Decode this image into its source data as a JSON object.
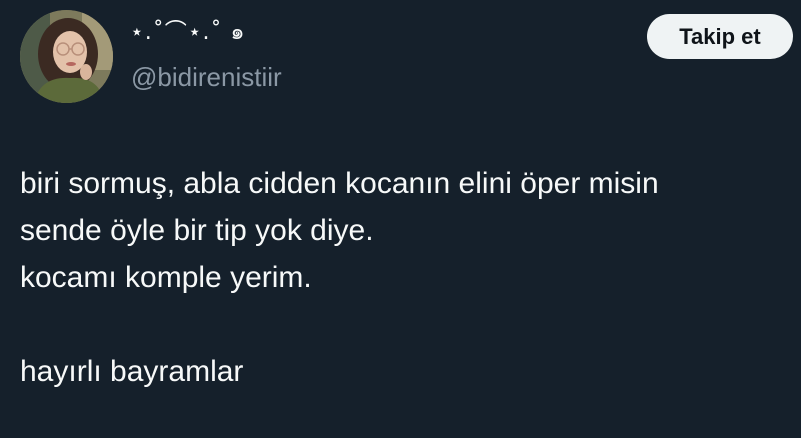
{
  "author": {
    "display_name": "⋆.˚⌒⋆.˚ ๑",
    "handle": "@bidirenistiir"
  },
  "follow_button": {
    "label": "Takip et"
  },
  "tweet": {
    "lines": [
      "biri sormuş, abla cidden kocanın elini öper misin",
      "sende öyle bir tip yok diye.",
      "kocamı komple yerim.",
      "",
      "hayırlı bayramlar"
    ]
  },
  "colors": {
    "background": "#15202b",
    "text": "#f7f9f9",
    "secondary_text": "#8b98a5",
    "button_background": "#eff3f4",
    "button_text": "#0f1419"
  }
}
